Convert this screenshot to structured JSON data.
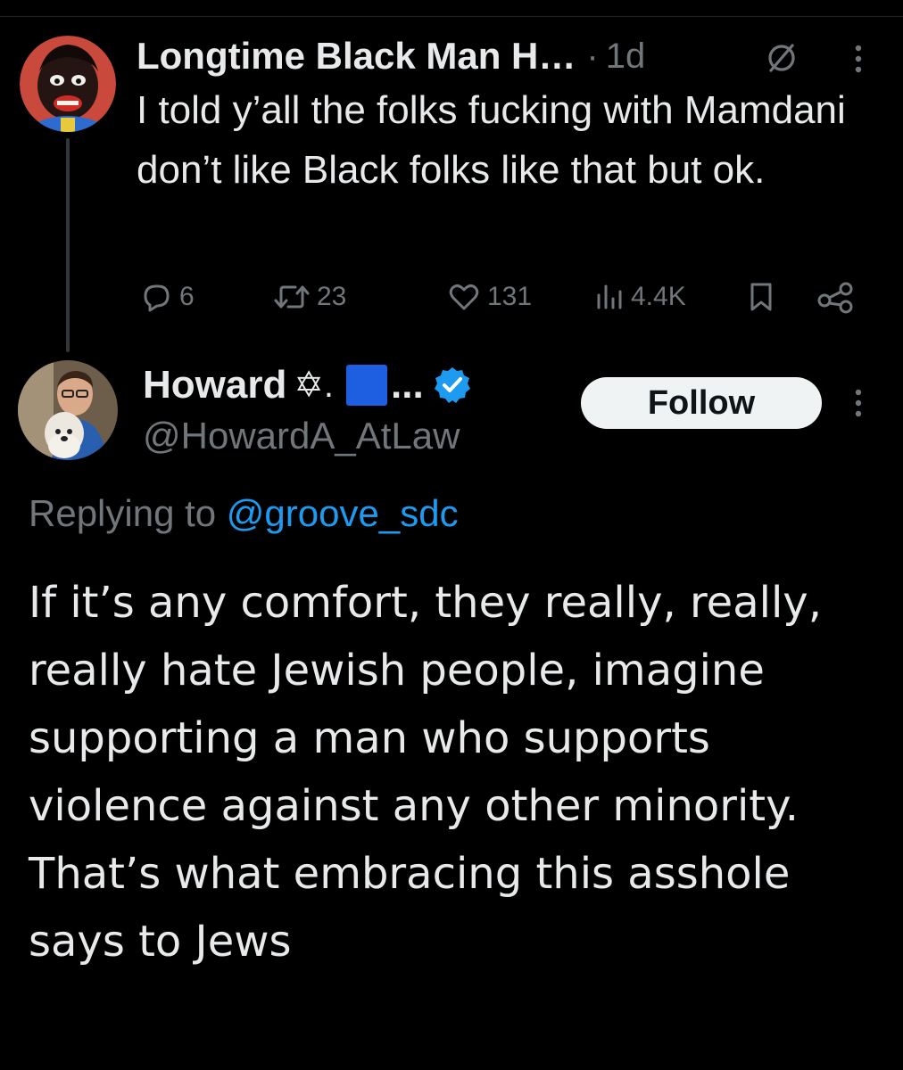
{
  "parent_tweet": {
    "display_name": "Longtime Black Man H…",
    "separator": "·",
    "time": "1d",
    "text": "I told y’all the folks fucking with Mamdani don’t like Black folks like that but ok.",
    "icons": {
      "grok": "grok-slash-icon",
      "more": "more-vertical-icon"
    },
    "actions": {
      "replies": "6",
      "reposts": "23",
      "likes": "131",
      "views": "4.4K"
    }
  },
  "reply_tweet": {
    "display_name": "Howard",
    "name_emoji": "✡.",
    "name_ellipsis": "...",
    "handle": "@HowardA_AtLaw",
    "follow_label": "Follow",
    "replying_prefix": "Replying to",
    "replying_to": "@groove_sdc",
    "text": "If it’s any comfort, they really, really, really hate Jewish people, imagine supporting a man who supports violence against any other minority. That’s what embracing this asshole says to Jews",
    "colors": {
      "flag_square": "#1d5fe0",
      "verified": "#1d9bf0",
      "mention": "#1d9bf0"
    }
  }
}
